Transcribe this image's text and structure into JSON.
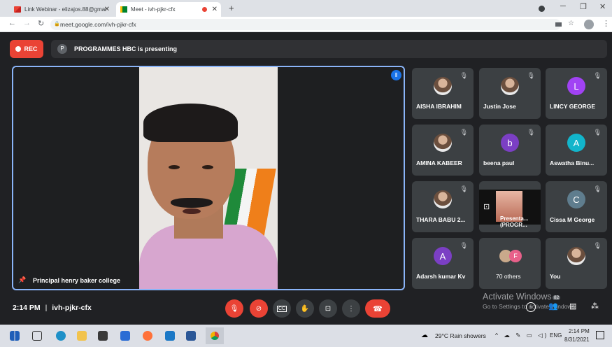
{
  "tabs": [
    {
      "title": "Link Webinar - elizajos.88@gmai",
      "close": "✕"
    },
    {
      "title": "Meet - ivh-pjkr-cfx",
      "close": "✕"
    }
  ],
  "new_tab": "+",
  "url": "meet.google.com/ivh-pjkr-cfx",
  "rec_label": "REC",
  "presenter_initial": "P",
  "presenting_text": "PROGRAMMES HBC is presenting",
  "main_speaker": "Principal henry baker college",
  "participants": [
    {
      "name": "AISHA IBRAHIM",
      "type": "photo"
    },
    {
      "name": "Justin Jose",
      "type": "photo"
    },
    {
      "name": "LINCY GEORGE",
      "initial": "L",
      "color": "#a142f4"
    },
    {
      "name": "AMINA KABEER",
      "type": "photo"
    },
    {
      "name": "beena paul",
      "initial": "b",
      "color": "#7b3fc4"
    },
    {
      "name": "Aswatha Binu...",
      "initial": "A",
      "color": "#12b5cb"
    },
    {
      "name": "THARA BABU 2...",
      "type": "photo"
    },
    {
      "name": "Presenta... (PROGR...",
      "type": "presentation"
    },
    {
      "name": "Cissa M George",
      "initial": "C",
      "color": "#5f7d8e"
    },
    {
      "name": "Adarsh kumar Kv",
      "initial": "A",
      "color": "#7b3fc4"
    },
    {
      "name": "70 others",
      "initial": "F",
      "color": "#e8608a"
    },
    {
      "name": "You",
      "type": "photo"
    }
  ],
  "meeting_time": "2:14 PM",
  "meeting_code": "ivh-pjkr-cfx",
  "activate_title": "Activate Windows",
  "activate_sub": "Go to Settings to activate Windows.",
  "people_count": "82",
  "weather": "29°C  Rain showers",
  "lang": "ENG",
  "clock_time": "2:14 PM",
  "clock_date": "8/31/2021"
}
